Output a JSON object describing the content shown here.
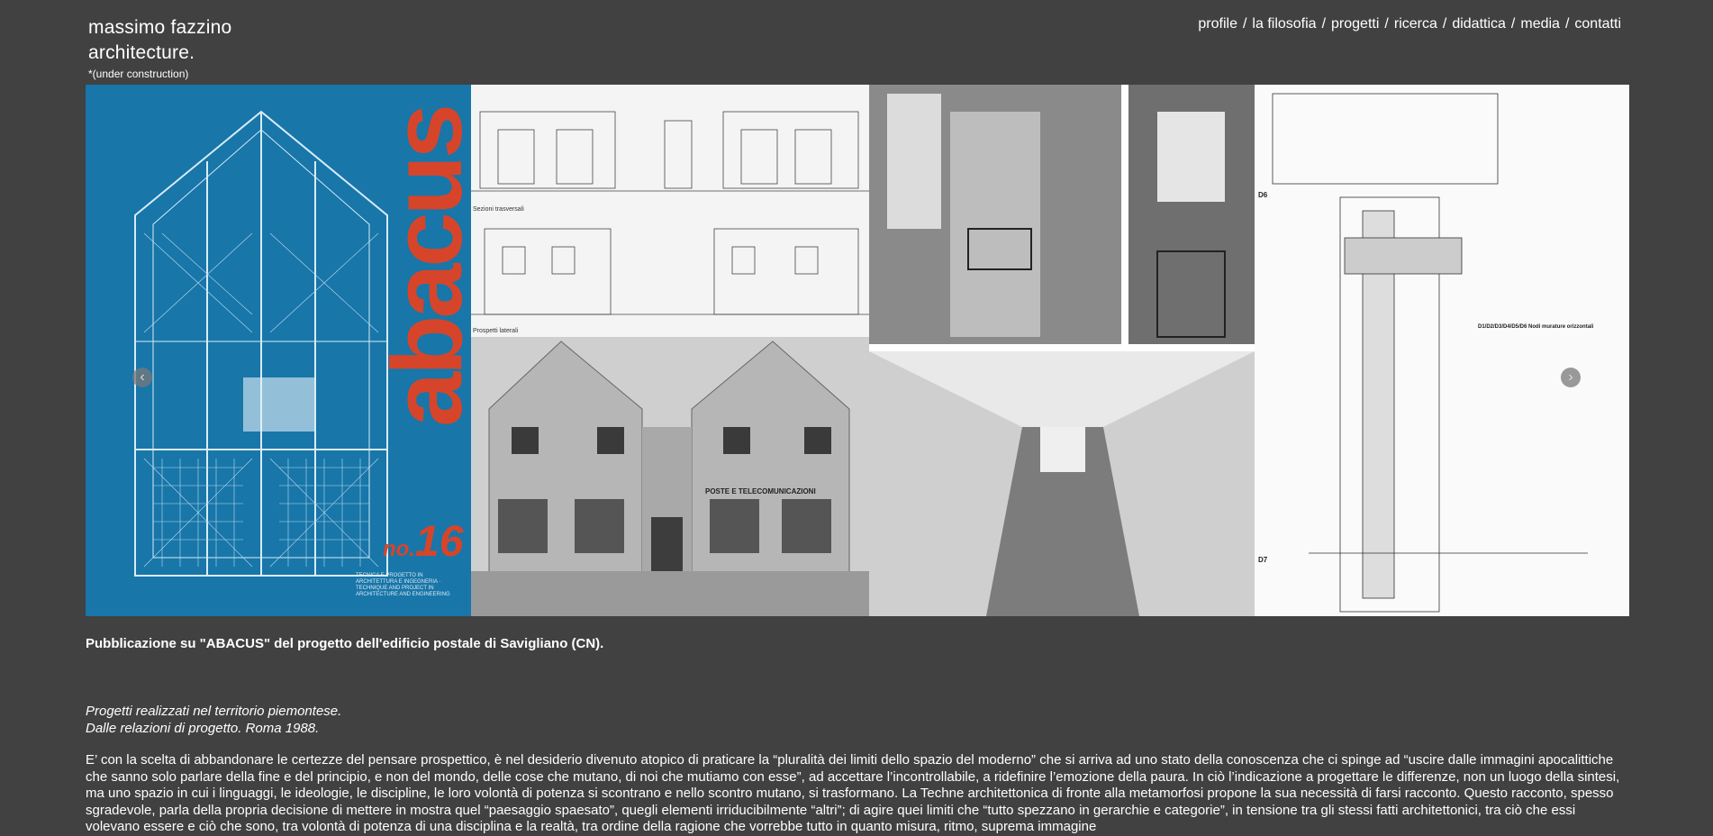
{
  "header": {
    "logo_line1": "massimo fazzino",
    "logo_line2": "architecture.",
    "logo_note": "*(under construction)"
  },
  "nav": {
    "items": [
      "profile",
      "la filosofia",
      "progetti",
      "ricerca",
      "didattica",
      "media",
      "contatti"
    ],
    "separator": "/"
  },
  "slider": {
    "cover_title": "abacus",
    "cover_issue_prefix": "no.",
    "cover_issue_number": "16",
    "cover_tagline": "TECNICA E PROGETTO IN ARCHITETTURA E INGEGNERIA · TECHNIQUE AND PROJECT IN ARCHITECTURE AND ENGINEERING",
    "drawing_label_1": "Sezioni trasversali",
    "drawing_label_2": "Prospetti laterali",
    "photo_sign": "POSTE E TELECOMUNICAZIONI",
    "detail_label_d6": "D6",
    "detail_label_d7": "D7",
    "detail_legend_title": "D1/D2/D3/D4/D5/D6 Nodi murature orizzontali",
    "prev_label": "‹",
    "next_label": "›"
  },
  "caption": "Pubblicazione su \"ABACUS\" del progetto dell'edificio postale di Savigliano (CN).",
  "subtitle": {
    "line1": "Progetti realizzati nel territorio piemontese.",
    "line2": "Dalle relazioni di progetto. Roma 1988."
  },
  "body_text": "E’ con la scelta di abbandonare le certezze del pensare prospettico, è nel desiderio divenuto atopico di praticare la “pluralità dei limiti dello spazio del moderno” che si arriva ad uno stato della conoscenza che ci spinge ad “uscire dalle immagini apocalittiche che sanno solo parlare della fine e del principio, e non del mondo, delle cose che mutano, di noi che mutiamo con esse”, ad accettare l’incontrollabile, a ridefinire l’emozione della paura. In ciò l’indicazione a progettare le differenze, non un luogo della sintesi, ma uno spazio in cui i linguaggi, le ideologie, le discipline, le loro volontà di potenza si scontrano e nello scontro mutano, si trasformano. La Techne architettonica di fronte alla metamorfosi propone la sua necessità di farsi racconto. Questo racconto, spesso sgradevole, parla della propria decisione di mettere in mostra quel “paesaggio spaesato”, quegli elementi irriducibilmente “altri”; di agire quei limiti che “tutto spezzano in gerarchie e categorie”, in tensione tra gli stessi fatti architettonici, tra ciò che essi volevano essere e ciò che sono, tra volontà di potenza di una disciplina e la realtà, tra ordine della ragione che vorrebbe tutto in quanto misura, ritmo, suprema immagine",
  "colors": {
    "background": "#414141",
    "text": "#ffffff",
    "cover_blue": "#1876a9",
    "cover_red": "#d6452a"
  }
}
